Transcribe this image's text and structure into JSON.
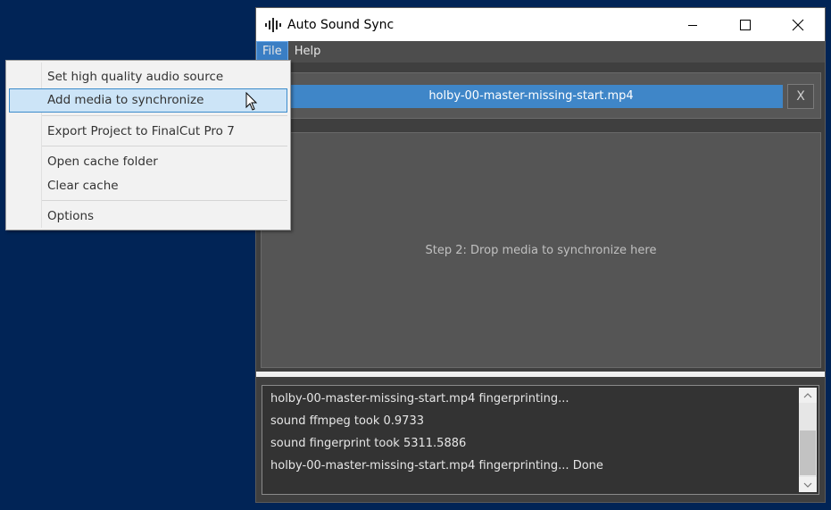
{
  "window": {
    "title": "Auto Sound Sync",
    "controls": {
      "minimize": "minimize",
      "maximize": "maximize",
      "close": "close"
    }
  },
  "menubar": {
    "items": [
      {
        "label": "File"
      },
      {
        "label": "Help"
      }
    ]
  },
  "file_menu": {
    "items": [
      {
        "label": "Set high quality audio source"
      },
      {
        "label": "Add media to synchronize"
      },
      {
        "label": "Export Project to FinalCut Pro 7"
      },
      {
        "label": "Open cache folder"
      },
      {
        "label": "Clear cache"
      },
      {
        "label": "Options"
      }
    ],
    "hovered": "Add media to synchronize"
  },
  "source": {
    "file_name": "holby-00-master-missing-start.mp4",
    "remove_label": "X"
  },
  "drop_zone": {
    "text": "Step 2: Drop media to synchronize here"
  },
  "log": {
    "lines": [
      "holby-00-master-missing-start.mp4 fingerprinting...",
      "sound ffmpeg took 0.9733",
      "sound fingerprint took 5311.5886",
      "holby-00-master-missing-start.mp4 fingerprinting... Done"
    ]
  },
  "colors": {
    "desktop": "#012456",
    "accent": "#3f86c8",
    "menu_hover": "#cce4f7",
    "window_bg": "#3f3f3f"
  }
}
